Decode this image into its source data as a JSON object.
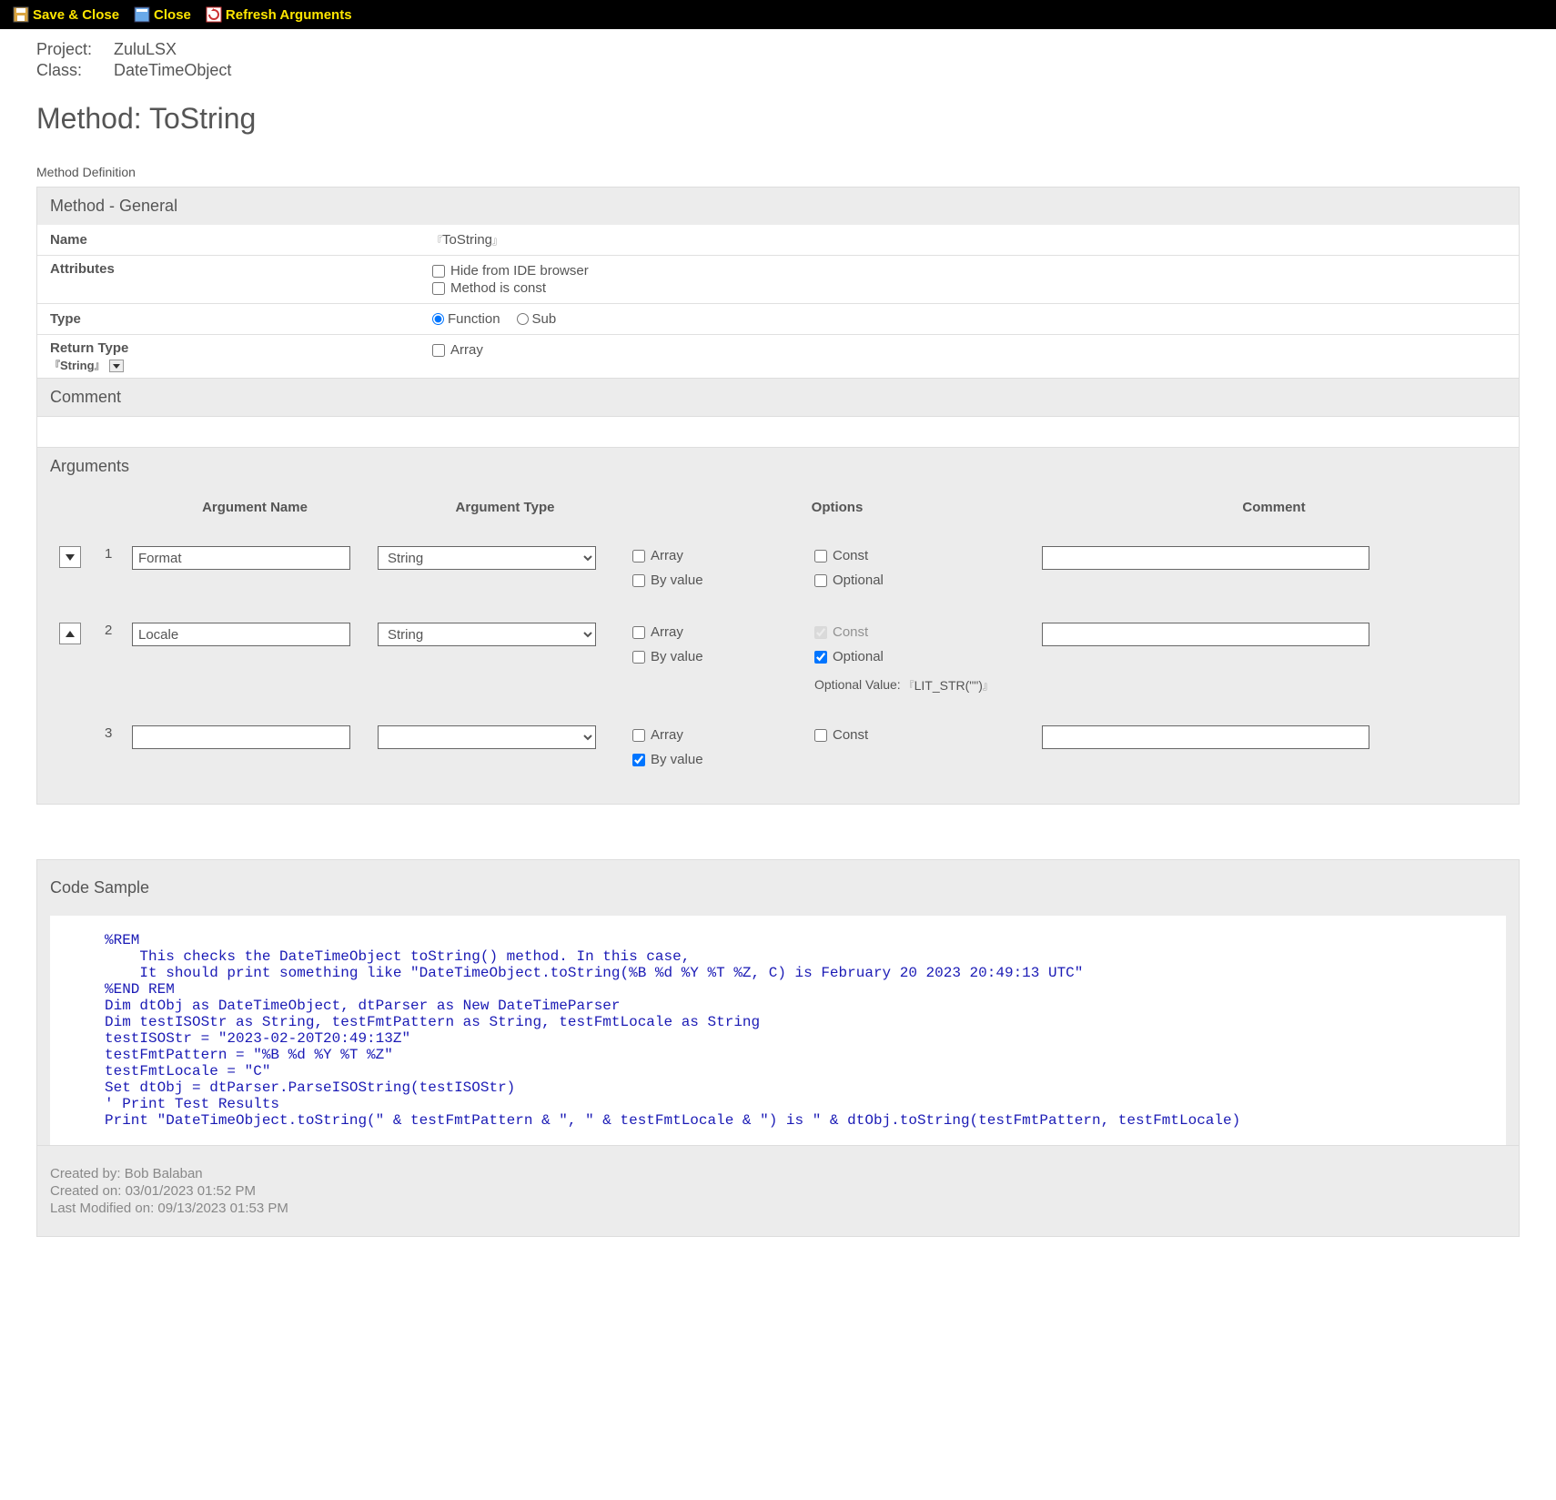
{
  "toolbar": {
    "save_close": "Save & Close",
    "close": "Close",
    "refresh": "Refresh Arguments"
  },
  "header": {
    "project_label": "Project:",
    "project_value": "ZuluLSX",
    "class_label": "Class:",
    "class_value": "DateTimeObject",
    "method_title": "Method: ToString",
    "method_def_label": "Method Definition"
  },
  "sections": {
    "general_title": "Method - General",
    "comment_title": "Comment",
    "arguments_title": "Arguments",
    "code_title": "Code Sample"
  },
  "general": {
    "name_label": "Name",
    "name_value": "ToString",
    "attributes_label": "Attributes",
    "hide_label": "Hide from IDE browser",
    "const_label": "Method is const",
    "type_label": "Type",
    "type_function": "Function",
    "type_sub": "Sub",
    "return_label": "Return Type",
    "return_value": "String",
    "array_label": "Array"
  },
  "arguments": {
    "headers": {
      "name": "Argument Name",
      "type": "Argument Type",
      "options": "Options",
      "comment": "Comment"
    },
    "opt_labels": {
      "array": "Array",
      "byvalue": "By value",
      "const": "Const",
      "optional": "Optional",
      "optional_value": "Optional Value:",
      "optional_value_val": "LIT_STR(\"\")"
    },
    "rows": [
      {
        "num": "1",
        "name": "Format",
        "type": "String",
        "array": false,
        "byvalue": false,
        "const": false,
        "optional": false,
        "show_optional": true,
        "const_disabled": false,
        "comment": ""
      },
      {
        "num": "2",
        "name": "Locale",
        "type": "String",
        "array": false,
        "byvalue": false,
        "const": true,
        "optional": true,
        "show_optional": true,
        "const_disabled": true,
        "comment": ""
      },
      {
        "num": "3",
        "name": "",
        "type": "",
        "array": false,
        "byvalue": true,
        "const": false,
        "optional": false,
        "show_optional": false,
        "const_disabled": false,
        "comment": ""
      }
    ]
  },
  "code_sample": "%REM\n    This checks the DateTimeObject toString() method. In this case,\n    It should print something like \"DateTimeObject.toString(%B %d %Y %T %Z, C) is February 20 2023 20:49:13 UTC\"\n%END REM\nDim dtObj as DateTimeObject, dtParser as New DateTimeParser\nDim testISOStr as String, testFmtPattern as String, testFmtLocale as String\ntestISOStr = \"2023-02-20T20:49:13Z\"\ntestFmtPattern = \"%B %d %Y %T %Z\"\ntestFmtLocale = \"C\"\nSet dtObj = dtParser.ParseISOString(testISOStr)\n' Print Test Results\nPrint \"DateTimeObject.toString(\" & testFmtPattern & \", \" & testFmtLocale & \") is \" & dtObj.toString(testFmtPattern, testFmtLocale)",
  "footer": {
    "created_by_label": "Created by:",
    "created_by_value": "Bob Balaban",
    "created_on_label": "Created on:",
    "created_on_value": "03/01/2023 01:52 PM",
    "modified_label": "Last Modified on:",
    "modified_value": "09/13/2023 01:53 PM"
  }
}
